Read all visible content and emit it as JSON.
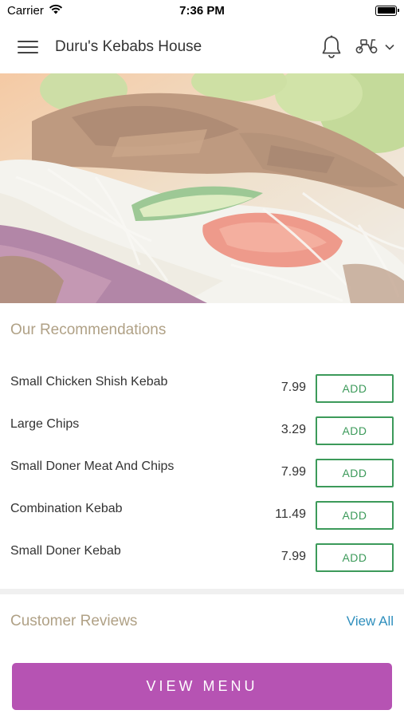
{
  "status_bar": {
    "carrier": "Carrier",
    "time": "7:36 PM"
  },
  "header": {
    "title": "Duru's Kebabs House"
  },
  "recommendations": {
    "title": "Our Recommendations",
    "items": [
      {
        "name": "Small Chicken Shish Kebab",
        "price": "7.99",
        "button": "ADD"
      },
      {
        "name": "Large Chips",
        "price": "3.29",
        "button": "ADD"
      },
      {
        "name": "Small Doner Meat And Chips",
        "price": "7.99",
        "button": "ADD"
      },
      {
        "name": "Combination Kebab",
        "price": "11.49",
        "button": "ADD"
      },
      {
        "name": "Small Doner Kebab",
        "price": "7.99",
        "button": "ADD"
      }
    ]
  },
  "reviews": {
    "title": "Customer Reviews",
    "view_all": "View All"
  },
  "footer": {
    "view_menu": "VIEW MENU"
  },
  "colors": {
    "accent_purple": "#b653b3",
    "add_green": "#3c9a5a",
    "link_blue": "#2f8fbd",
    "section_title": "#b0a186"
  },
  "icons": [
    "wifi-icon",
    "battery-icon",
    "hamburger-menu-icon",
    "bell-icon",
    "scooter-icon",
    "chevron-down-icon"
  ]
}
